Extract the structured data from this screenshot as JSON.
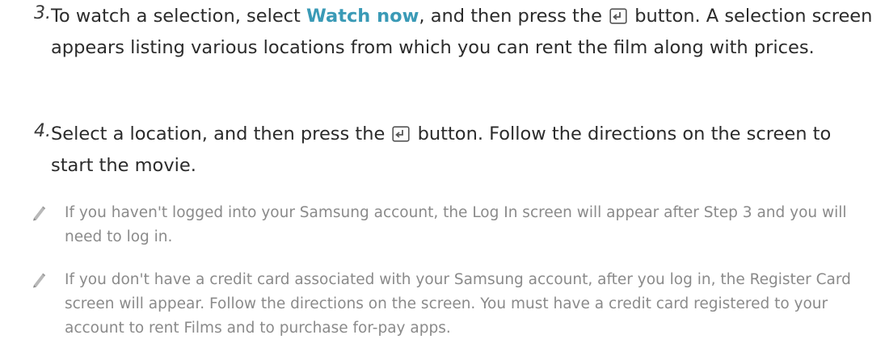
{
  "steps": [
    {
      "number": "3.",
      "part1": "To watch a selection, select ",
      "highlight": "Watch now",
      "part2": ", and then press the ",
      "part3": " button. A selection screen appears listing various locations from which you can rent the film along with prices."
    },
    {
      "number": "4.",
      "part1": "Select a location, and then press the ",
      "part2": " button. Follow the directions on the screen to start the movie."
    }
  ],
  "notes": [
    {
      "icon": "pencil-icon",
      "text": "If you haven't logged into your Samsung account, the Log In screen will appear after Step 3 and you will need to log in."
    },
    {
      "icon": "pencil-icon",
      "text": "If you don't have a credit card associated with your Samsung account, after you log in, the Register Card screen will appear. Follow the directions on the screen. You must have a credit card registered to your account to rent Films and to purchase for-pay apps."
    }
  ],
  "colors": {
    "highlight": "#3a9ab6",
    "body_text": "#2b2b2b",
    "note_text": "#8a8a8a"
  }
}
